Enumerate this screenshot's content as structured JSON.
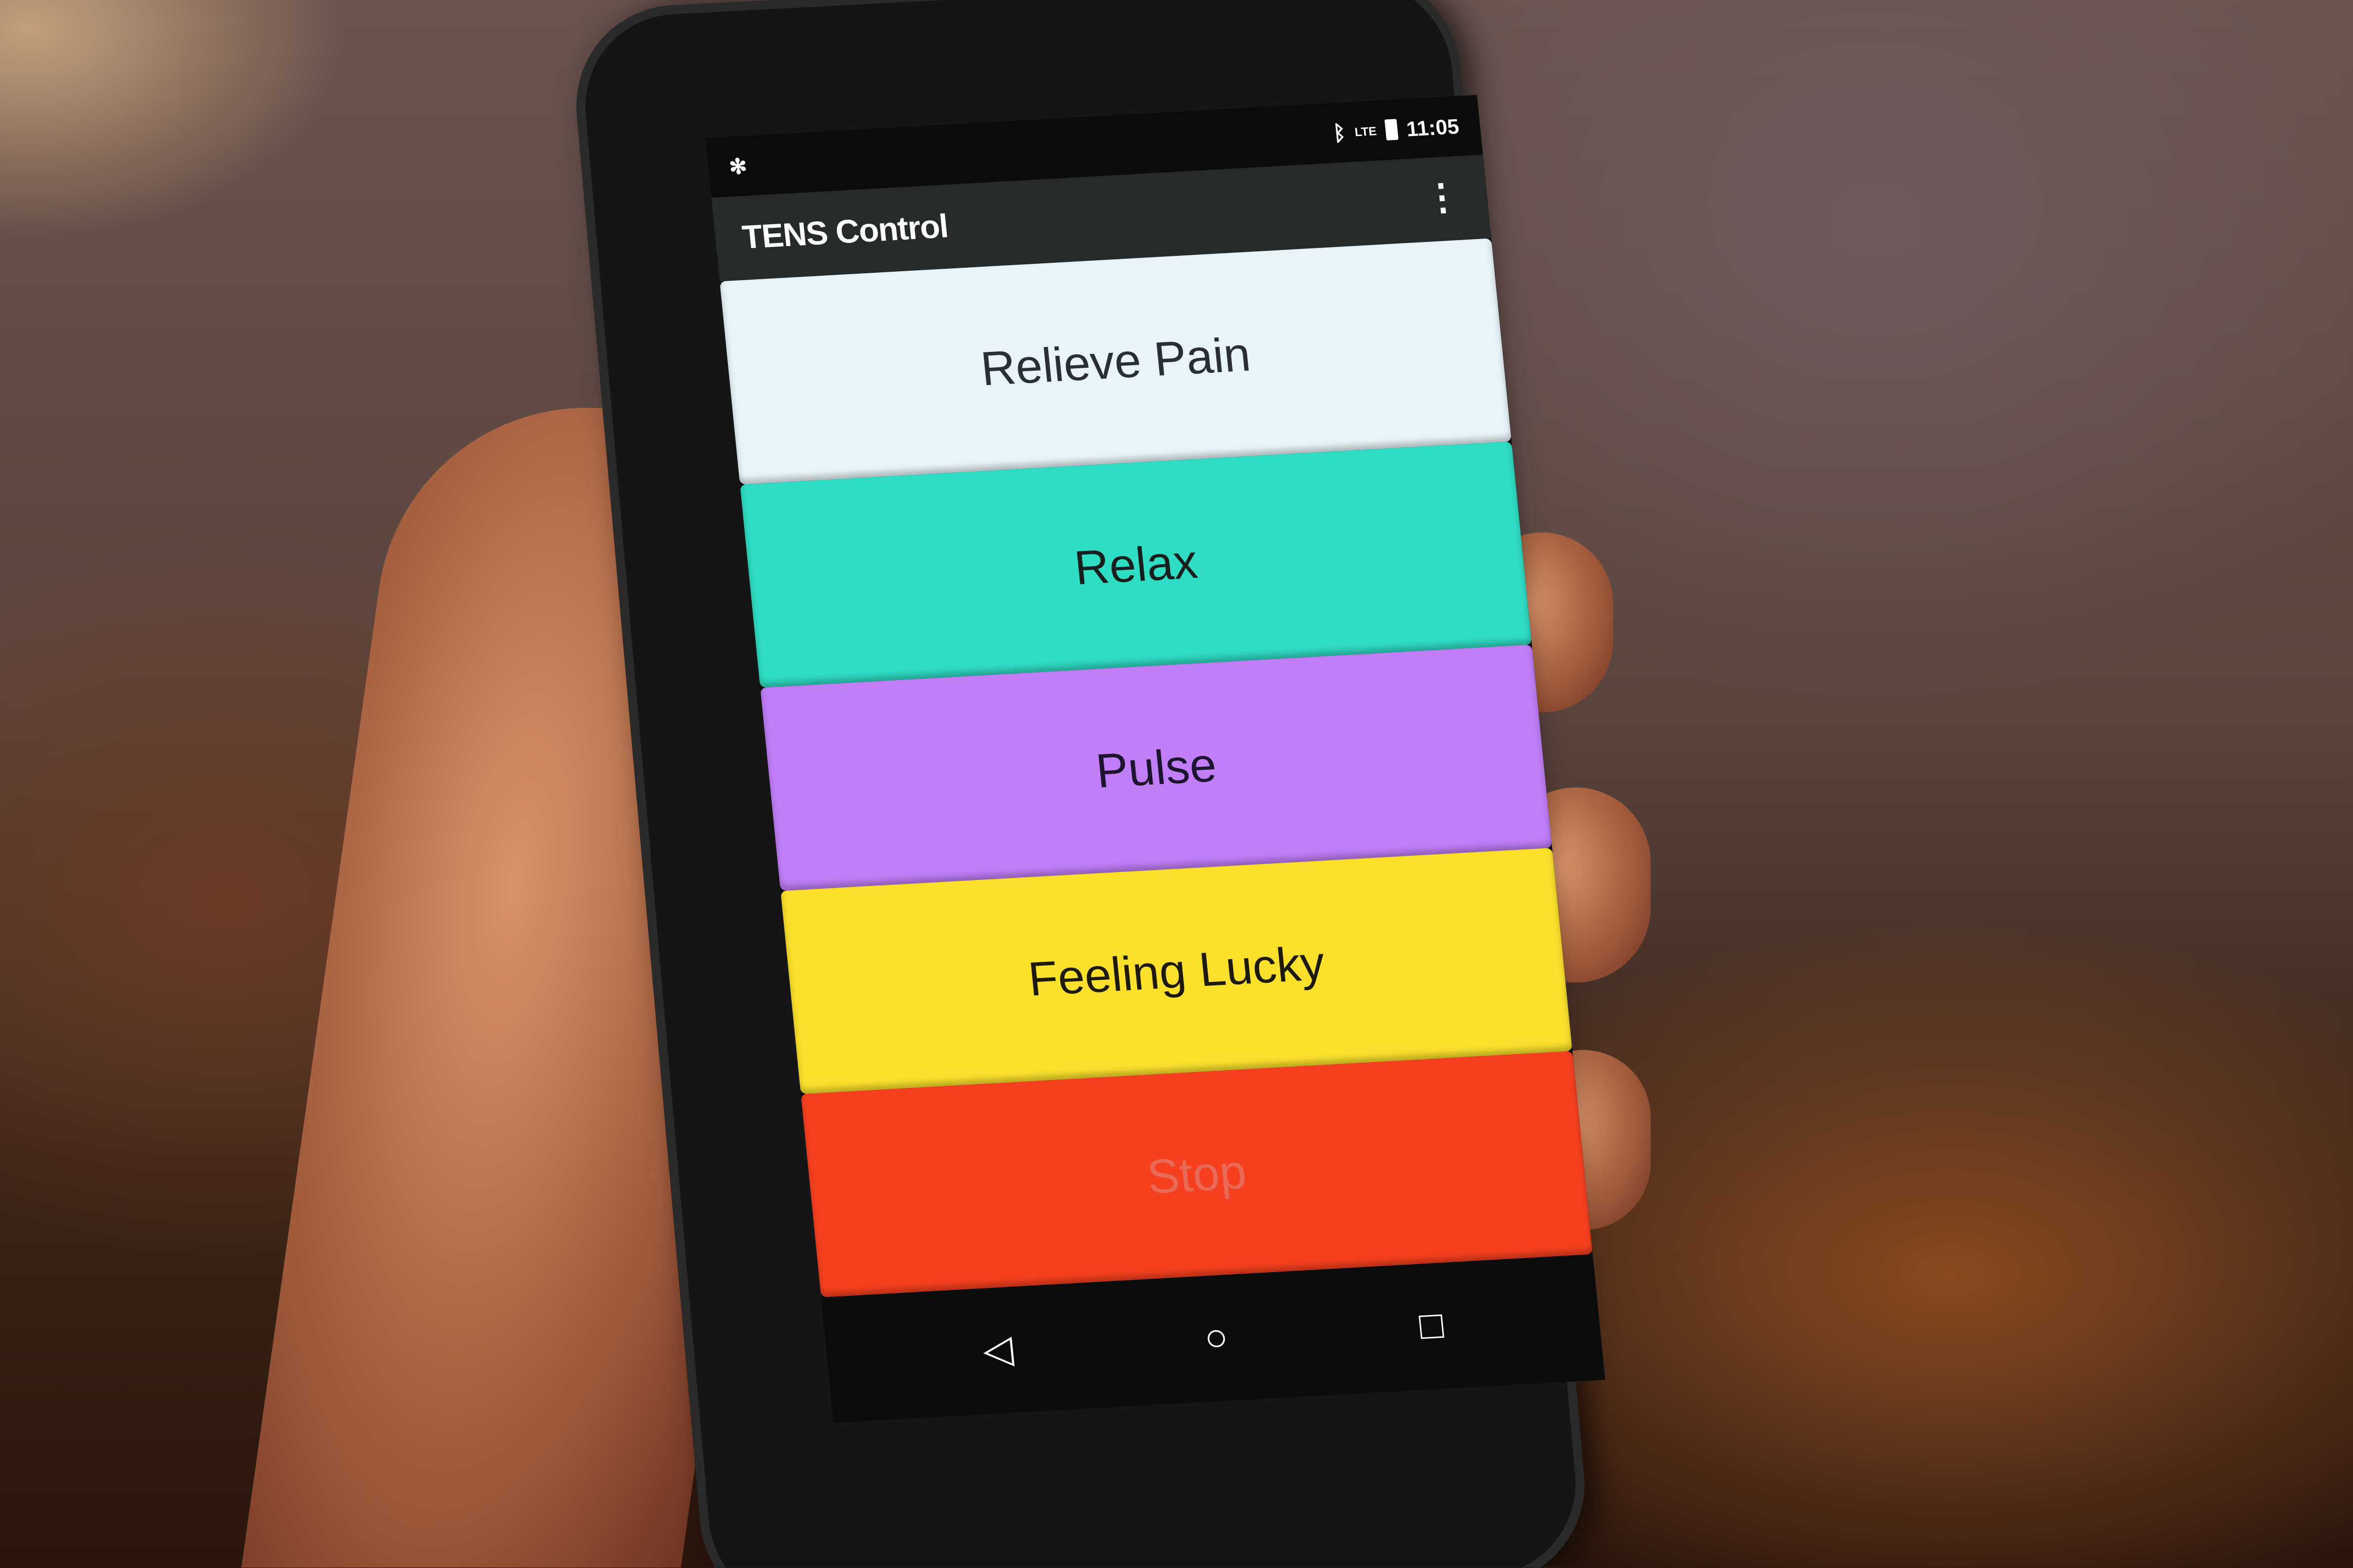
{
  "status_bar": {
    "time": "11:05",
    "icons": [
      "app-notification-icon",
      "bluetooth-icon",
      "lte-signal-icon",
      "battery-icon"
    ],
    "lte_label": "LTE"
  },
  "app_bar": {
    "title": "TENS Control",
    "menu_icon": "overflow-menu-icon"
  },
  "buttons": [
    {
      "label": "Relieve Pain",
      "color": "#e8f4f8",
      "text_color": "#2a2f33"
    },
    {
      "label": "Relax",
      "color": "#2fdcc4",
      "text_color": "#15201e"
    },
    {
      "label": "Pulse",
      "color": "#c17ef7",
      "text_color": "#1d1530"
    },
    {
      "label": "Feeling Lucky",
      "color": "#fbe12c",
      "text_color": "#1e1a08"
    },
    {
      "label": "Stop",
      "color": "#f7401f",
      "text_color": "#e86a56"
    }
  ],
  "nav_bar": {
    "icons": [
      "back-icon",
      "home-icon",
      "recents-icon"
    ]
  }
}
